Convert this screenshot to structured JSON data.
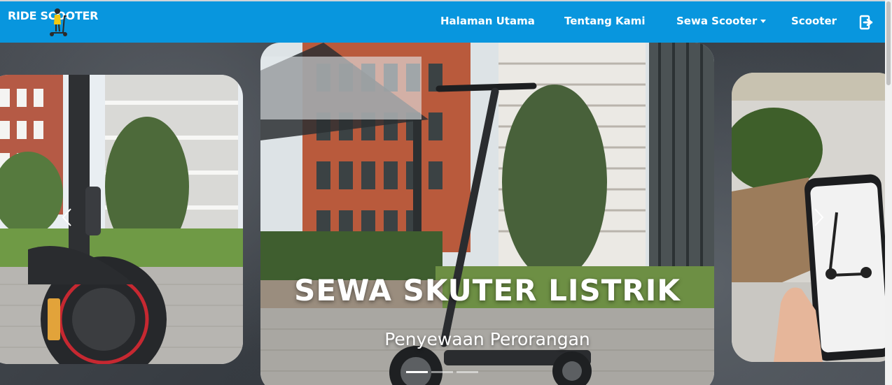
{
  "brand": {
    "name": "RIDE SCOOTER",
    "icon": "scooter-rider-logo"
  },
  "nav": {
    "items": [
      {
        "label": "Halaman Utama"
      },
      {
        "label": "Tentang Kami"
      },
      {
        "label": "Sewa Scooter",
        "has_dropdown": true
      },
      {
        "label": "Scooter"
      }
    ],
    "logout_icon": "logout-icon"
  },
  "hero": {
    "title": "SEWA SKUTER LISTRIK",
    "subtitle": "Penyewaan Perorangan",
    "slide_count": 3,
    "active_slide": 1
  },
  "colors": {
    "navbar": "#0896de",
    "nav_text": "#ffffff"
  }
}
